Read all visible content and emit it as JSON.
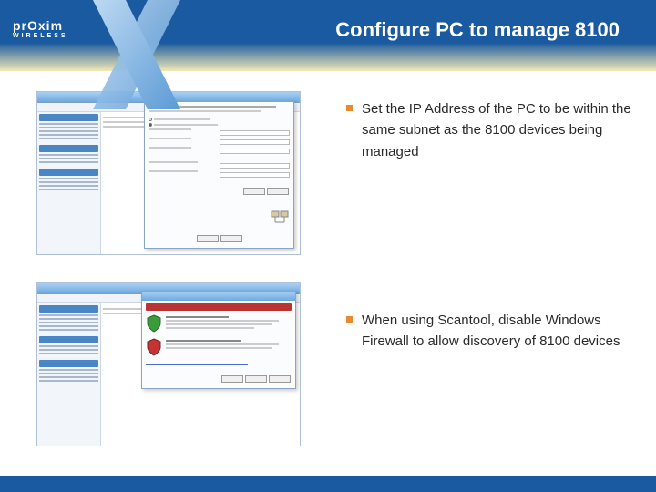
{
  "brand": {
    "name": "prOxim",
    "tagline": "WIRELESS"
  },
  "title": "Configure PC to manage 8100",
  "bullets": [
    "Set the IP Address of the PC to be within the same subnet as the 8100 devices being managed",
    "When using Scantool, disable Windows Firewall to allow discovery of 8100 devices"
  ]
}
